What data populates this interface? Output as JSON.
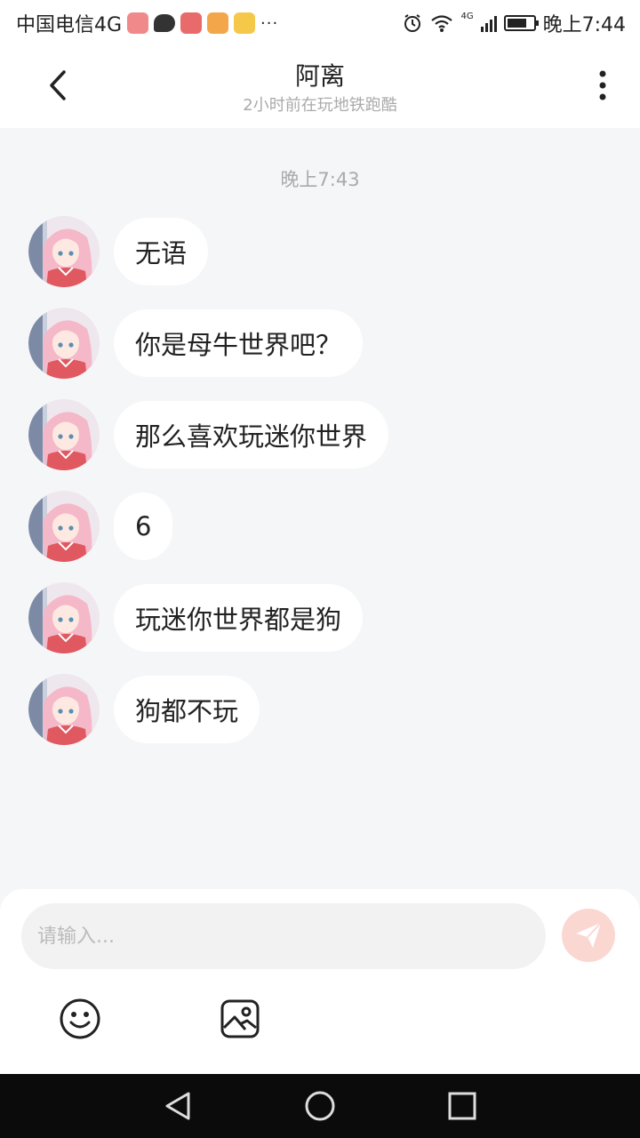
{
  "status_bar": {
    "carrier": "中国电信4G",
    "app_icons": [
      "shop-icon",
      "chat-icon",
      "sg-app-icon",
      "video-icon",
      "notes-icon"
    ],
    "more": "···",
    "network_badge": "4G",
    "time": "晚上7:44"
  },
  "header": {
    "title": "阿离",
    "subtitle": "2小时前在玩地铁跑酷"
  },
  "chat": {
    "time_separator": "晚上7:43",
    "messages": [
      {
        "text": "无语"
      },
      {
        "text": "你是母牛世界吧？"
      },
      {
        "text": "那么喜欢玩迷你世界"
      },
      {
        "text": "6"
      },
      {
        "text": "玩迷你世界都是狗"
      },
      {
        "text": "狗都不玩"
      }
    ]
  },
  "input": {
    "placeholder": "请输入...",
    "value": ""
  },
  "colors": {
    "background": "#f5f6f8",
    "send_button": "#fbd7d2",
    "avatar_hair": "#f4b8c8",
    "avatar_outfit": "#e05860"
  }
}
